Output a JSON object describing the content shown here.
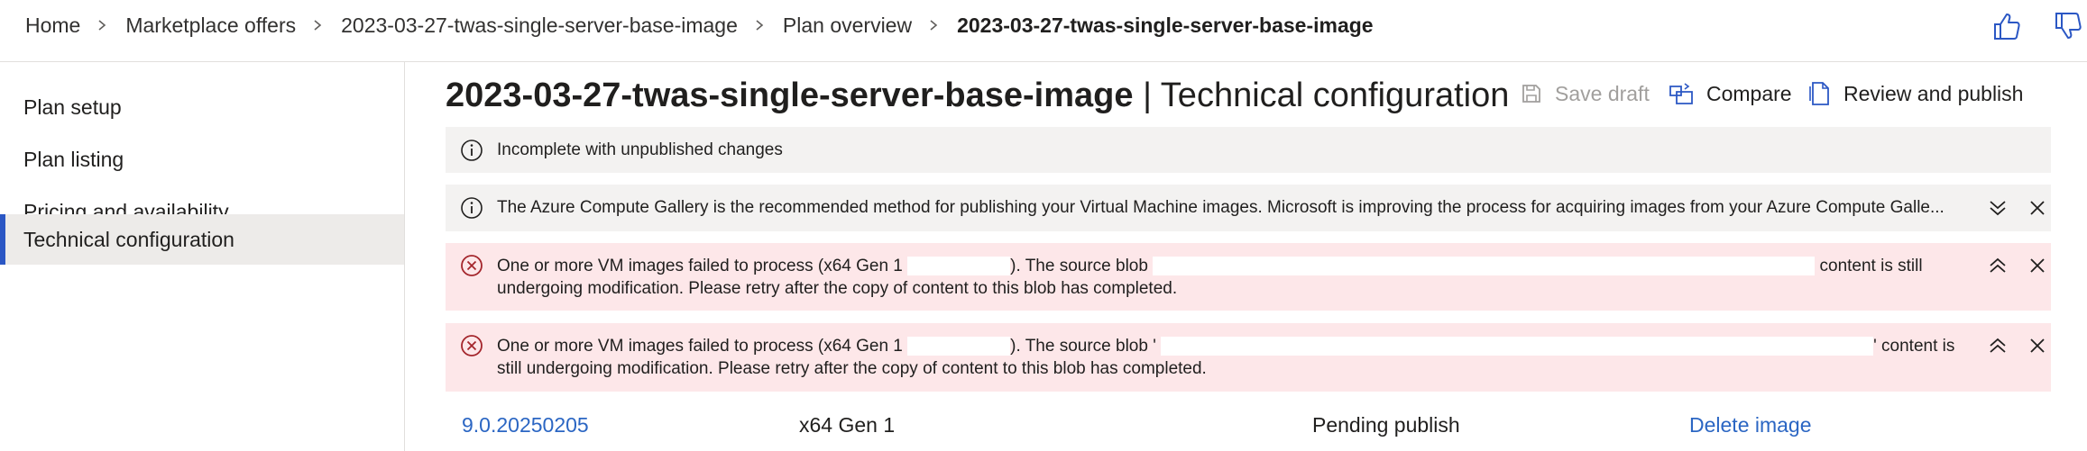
{
  "breadcrumb": {
    "items": [
      "Home",
      "Marketplace offers",
      "2023-03-27-twas-single-server-base-image",
      "Plan overview"
    ],
    "current": "2023-03-27-twas-single-server-base-image"
  },
  "nav": {
    "items": [
      "Plan setup",
      "Plan listing",
      "Pricing and availability",
      "Technical configuration"
    ],
    "active": "Technical configuration"
  },
  "header": {
    "plan_name": "2023-03-27-twas-single-server-base-image",
    "page_name": "| Technical configuration"
  },
  "commands": {
    "save_draft": "Save draft",
    "compare": "Compare",
    "review_publish": "Review and publish"
  },
  "messages": {
    "status": "Incomplete with unpublished changes",
    "gallery": "The Azure Compute Gallery is the recommended method for publishing your Virtual Machine images. Microsoft is improving the process for acquiring images from your Azure Compute Galle...",
    "error1_a": "One or more VM images failed to process (x64 Gen 1",
    "error1_b": "). The source blob",
    "error1_c": "content is still",
    "error1_line2": "undergoing modification. Please retry after the copy of content to this blob has completed.",
    "error2_a": "One or more VM images failed to process (x64 Gen 1",
    "error2_b": "). The source blob '",
    "error2_c": "' content is",
    "error2_line2": "still undergoing modification. Please retry after the copy of content to this blob has completed."
  },
  "image_row": {
    "version": "9.0.20250205",
    "generation": "x64 Gen 1",
    "status": "Pending publish",
    "action": "Delete image"
  },
  "colors": {
    "accent": "#2b57c4",
    "link": "#2b66c3",
    "error_bg": "#fde7e9",
    "error_icon": "#a4262c",
    "info_bg": "#f3f2f1"
  }
}
